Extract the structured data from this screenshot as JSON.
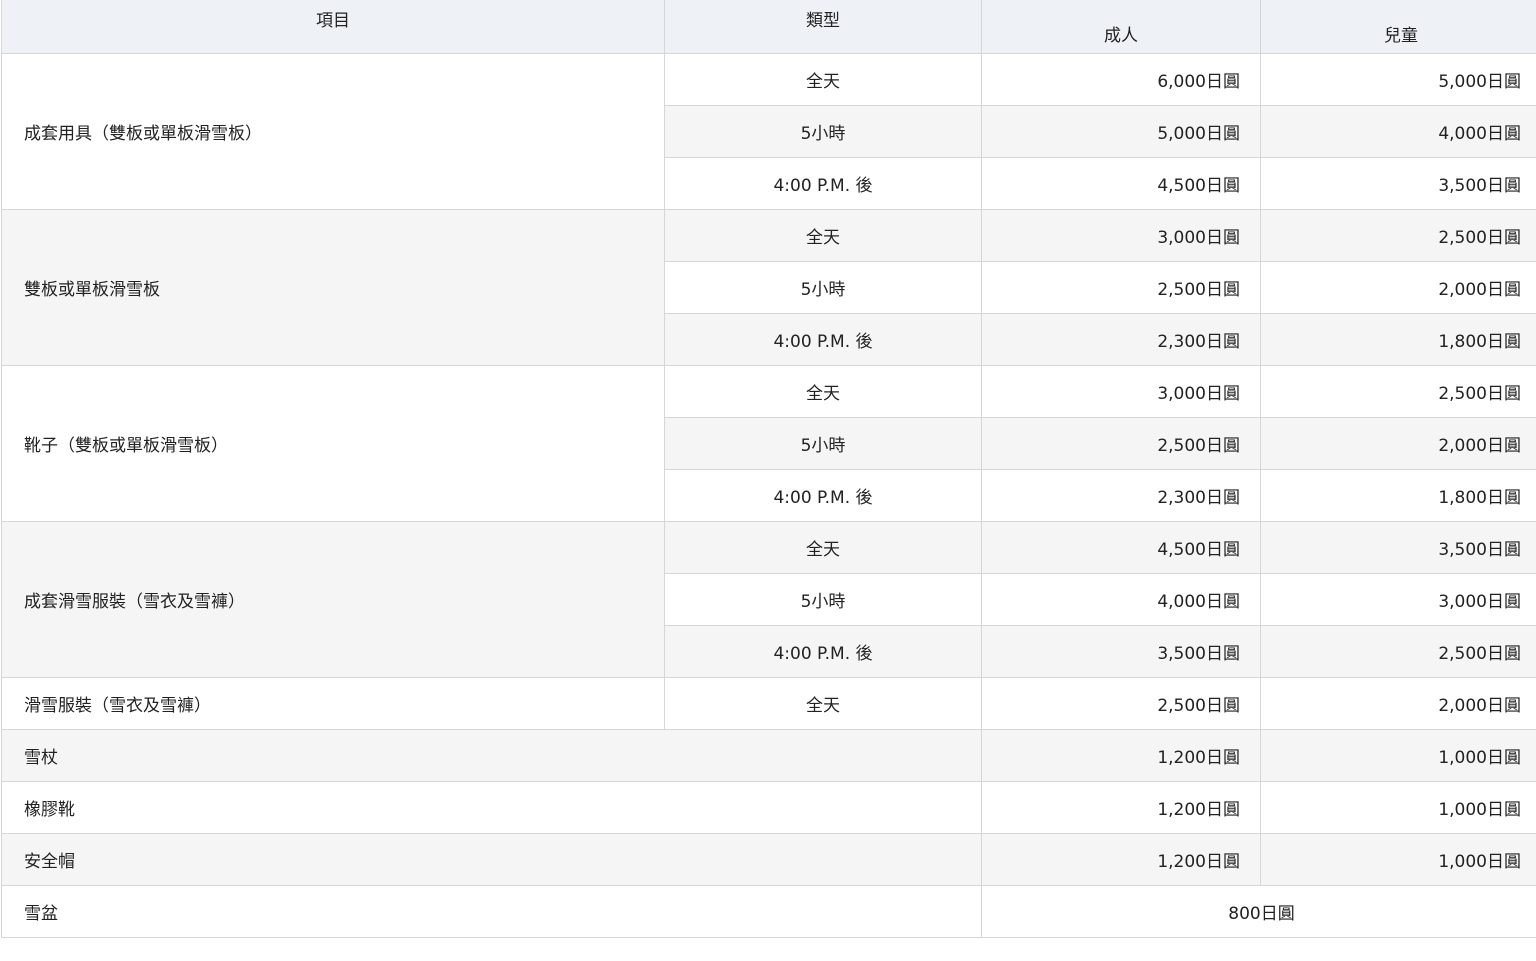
{
  "header": {
    "item": "項目",
    "type": "類型",
    "adult": "成人",
    "child": "兒童"
  },
  "groups": [
    {
      "item": "成套用具（雙板或單板滑雪板）",
      "rows": [
        {
          "type": "全天",
          "adult": "6,000日圓",
          "child": "5,000日圓"
        },
        {
          "type": "5小時",
          "adult": "5,000日圓",
          "child": "4,000日圓"
        },
        {
          "type": "4:00 P.M. 後",
          "adult": "4,500日圓",
          "child": "3,500日圓"
        }
      ]
    },
    {
      "item": "雙板或單板滑雪板",
      "rows": [
        {
          "type": "全天",
          "adult": "3,000日圓",
          "child": "2,500日圓"
        },
        {
          "type": "5小時",
          "adult": "2,500日圓",
          "child": "2,000日圓"
        },
        {
          "type": "4:00 P.M. 後",
          "adult": "2,300日圓",
          "child": "1,800日圓"
        }
      ]
    },
    {
      "item": "靴子（雙板或單板滑雪板）",
      "rows": [
        {
          "type": "全天",
          "adult": "3,000日圓",
          "child": "2,500日圓"
        },
        {
          "type": "5小時",
          "adult": "2,500日圓",
          "child": "2,000日圓"
        },
        {
          "type": "4:00 P.M. 後",
          "adult": "2,300日圓",
          "child": "1,800日圓"
        }
      ]
    },
    {
      "item": "成套滑雪服裝（雪衣及雪褲）",
      "rows": [
        {
          "type": "全天",
          "adult": "4,500日圓",
          "child": "3,500日圓"
        },
        {
          "type": "5小時",
          "adult": "4,000日圓",
          "child": "3,000日圓"
        },
        {
          "type": "4:00 P.M. 後",
          "adult": "3,500日圓",
          "child": "2,500日圓"
        }
      ]
    }
  ],
  "single": {
    "item": "滑雪服裝（雪衣及雪褲）",
    "type": "全天",
    "adult": "2,500日圓",
    "child": "2,000日圓"
  },
  "simple": [
    {
      "item": "雪杖",
      "adult": "1,200日圓",
      "child": "1,000日圓"
    },
    {
      "item": "橡膠靴",
      "adult": "1,200日圓",
      "child": "1,000日圓"
    },
    {
      "item": "安全帽",
      "adult": "1,200日圓",
      "child": "1,000日圓"
    }
  ],
  "sled": {
    "item": "雪盆",
    "price": "800日圓"
  }
}
